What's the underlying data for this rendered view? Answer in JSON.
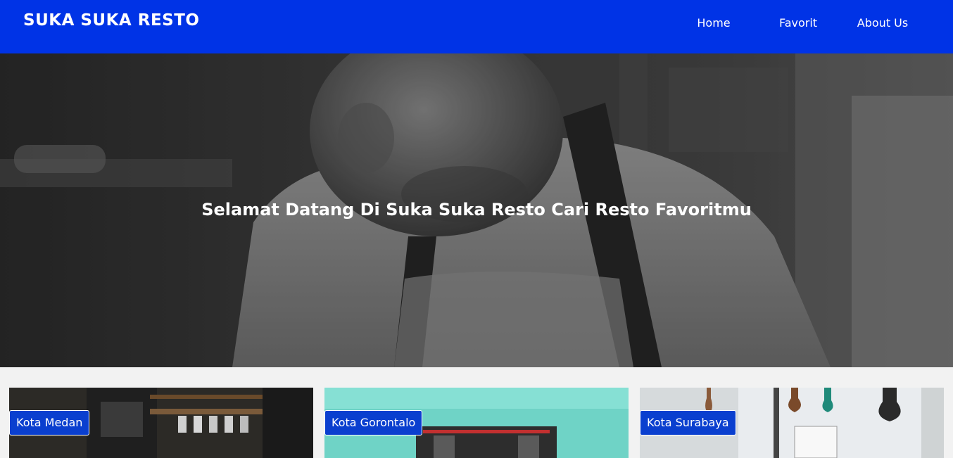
{
  "header": {
    "brand": "SUKA SUKA RESTO",
    "nav": [
      {
        "label": "Home"
      },
      {
        "label": "Favorit"
      },
      {
        "label": "About Us"
      }
    ],
    "background_color": "#0033e6"
  },
  "hero": {
    "title": "Selamat Datang Di Suka Suka Resto Cari Resto Favoritmu",
    "image_description_icon": "chef-photo"
  },
  "cards": [
    {
      "label": "Kota Medan"
    },
    {
      "label": "Kota Gorontalo"
    },
    {
      "label": "Kota Surabaya"
    }
  ],
  "colors": {
    "accent": "#0033e6",
    "label_bg": "#0a3fcf",
    "page_bg": "#f2f2f2"
  }
}
